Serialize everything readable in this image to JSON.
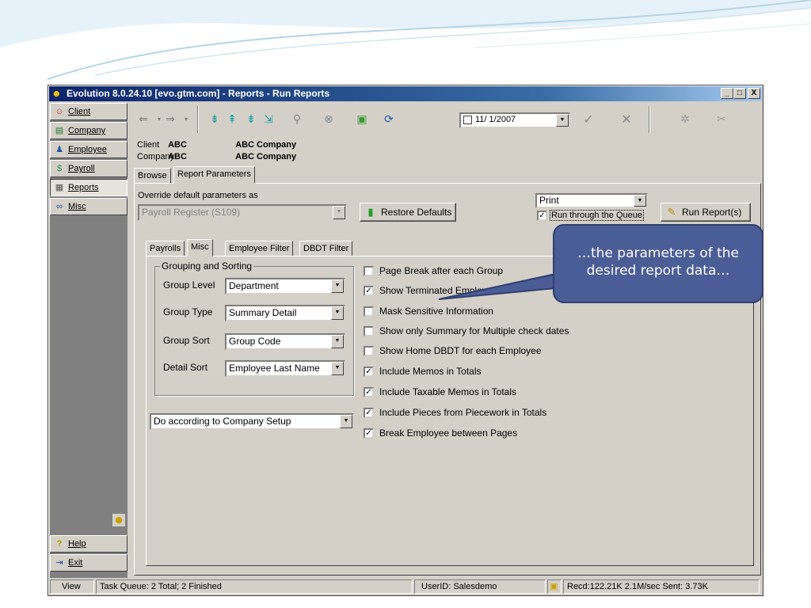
{
  "window": {
    "title": "Evolution 8.0.24.10 [evo.gtm.com] - Reports - Run Reports",
    "buttons": {
      "minimize": "_",
      "maximize": "□",
      "close": "X"
    }
  },
  "nav": {
    "items": [
      {
        "label": "Client",
        "icon": "client-icon"
      },
      {
        "label": "Company",
        "icon": "company-icon"
      },
      {
        "label": "Employee",
        "icon": "employee-icon"
      },
      {
        "label": "Payroll",
        "icon": "payroll-icon"
      },
      {
        "label": "Reports",
        "icon": "reports-icon"
      },
      {
        "label": "Misc",
        "icon": "misc-icon"
      }
    ],
    "help": "Help",
    "exit": "Exit"
  },
  "toolbar": {
    "date": "11/ 1/2007"
  },
  "info": {
    "client_label": "Client",
    "client_code": "ABC",
    "client_name": "ABC Company",
    "company_label": "Company",
    "company_code": "ABC",
    "company_name": "ABC Company"
  },
  "tabs": {
    "browse": "Browse",
    "report_parameters": "Report Parameters"
  },
  "params": {
    "override_label": "Override default parameters as",
    "override_value": "Payroll Register (S109)",
    "restore_defaults": "Restore Defaults",
    "output_value": "Print",
    "run_queue_label": "Run through the Queue",
    "run_queue_checked": true,
    "run_report": "Run Report(s)"
  },
  "subtabs": {
    "payrolls": "Payrolls",
    "misc": "Misc",
    "employee_filter": "Employee Filter",
    "dbdt_filter": "DBDT Filter"
  },
  "grouping": {
    "title": "Grouping and Sorting",
    "group_level_label": "Group Level",
    "group_level": "Department",
    "group_type_label": "Group Type",
    "group_type": "Summary Detail",
    "group_sort_label": "Group Sort",
    "group_sort": "Group Code",
    "detail_sort_label": "Detail Sort",
    "detail_sort": "Employee Last Name",
    "company_setup": "Do according to Company Setup"
  },
  "options": [
    {
      "label": "Page Break after each Group",
      "checked": false
    },
    {
      "label": "Show Terminated Employees",
      "checked": true
    },
    {
      "label": "Mask Sensitive Information",
      "checked": false
    },
    {
      "label": "Show only Summary for Multiple check dates",
      "checked": false
    },
    {
      "label": "Show Home DBDT for each Employee",
      "checked": false
    },
    {
      "label": "Include Memos in Totals",
      "checked": true
    },
    {
      "label": "Include Taxable Memos in Totals",
      "checked": true
    },
    {
      "label": "Include Pieces from Piecework in Totals",
      "checked": true
    },
    {
      "label": "Break Employee between Pages",
      "checked": true
    }
  ],
  "status": {
    "view": "View",
    "task_queue": "Task Queue: 2 Total; 2 Finished",
    "user": "UserID: Salesdemo",
    "traffic": "Recd:122.21K  2.1M/sec  Sent: 3.73K"
  },
  "callout": {
    "text": "…the parameters of the desired report data…"
  },
  "colors": {
    "title_bar": "#0a246a",
    "callout": "#4a5d96",
    "window_face": "#d4d0c8"
  }
}
